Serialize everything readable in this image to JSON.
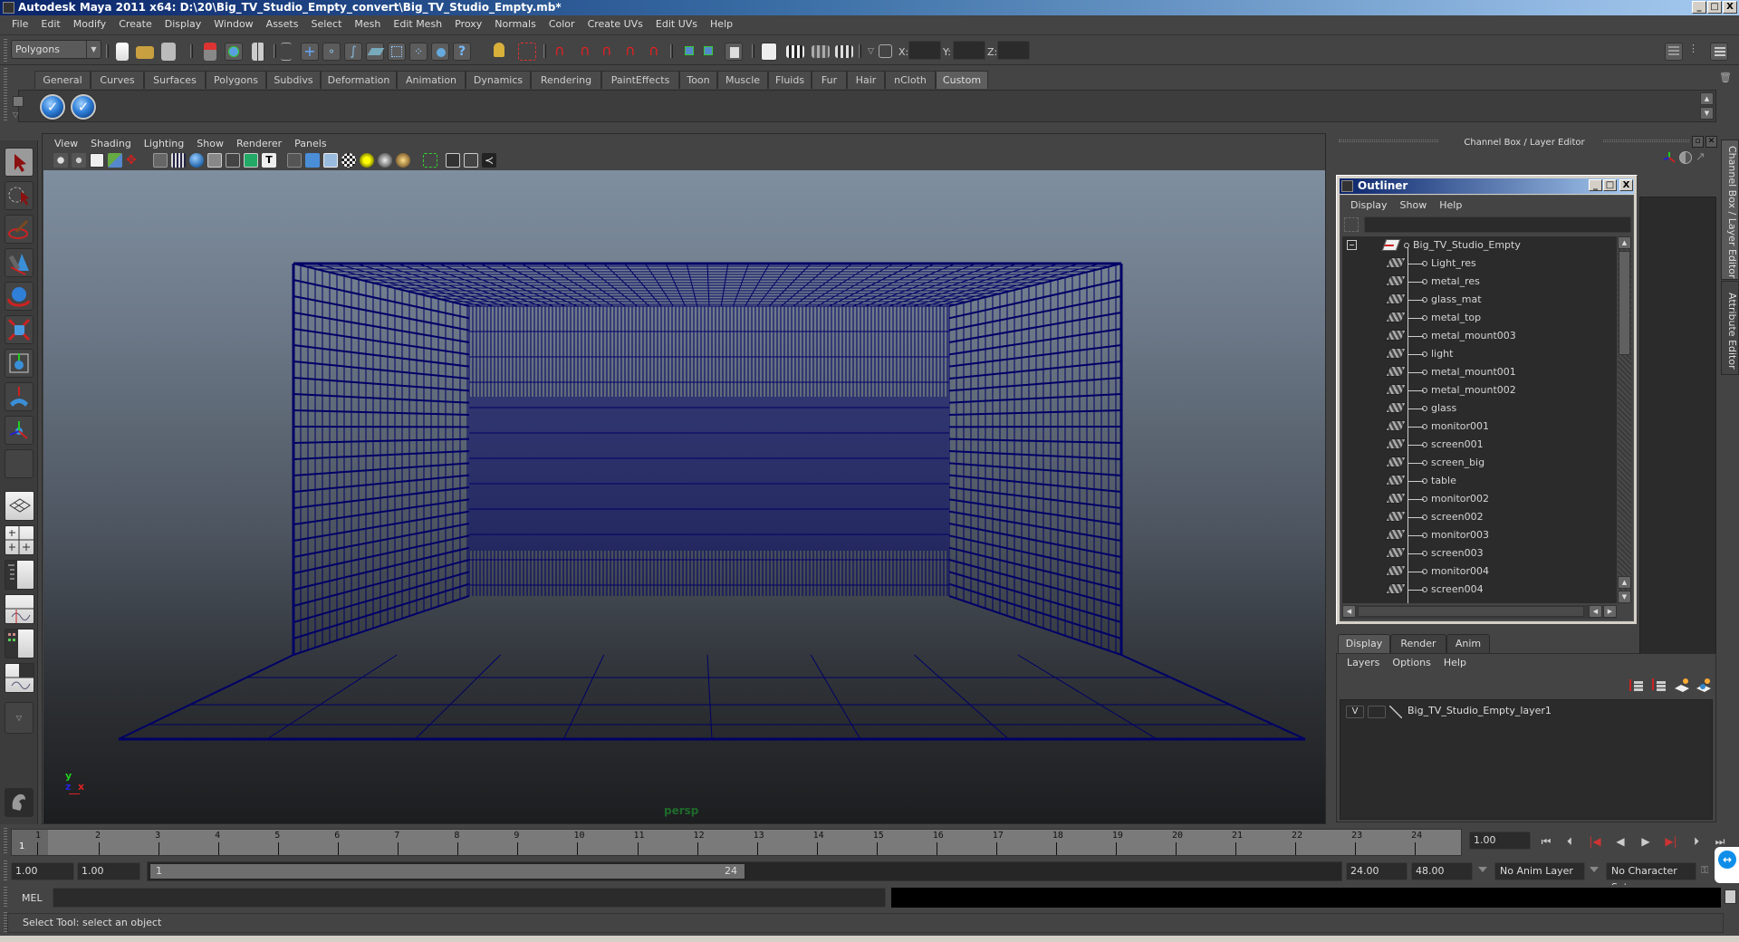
{
  "window": {
    "title": "Autodesk Maya 2011 x64: D:\\20\\Big_TV_Studio_Empty_convert\\Big_TV_Studio_Empty.mb*",
    "controls": [
      "_",
      "□",
      "X"
    ]
  },
  "menubar": [
    "File",
    "Edit",
    "Modify",
    "Create",
    "Display",
    "Window",
    "Assets",
    "Select",
    "Mesh",
    "Edit Mesh",
    "Proxy",
    "Normals",
    "Color",
    "Create UVs",
    "Edit UVs",
    "Help"
  ],
  "statusline": {
    "mode": "Polygons",
    "coord_labels": {
      "x": "X:",
      "y": "Y:",
      "z": "Z:"
    },
    "coord_values": {
      "x": "",
      "y": "",
      "z": ""
    },
    "icons": [
      "new-scene-icon",
      "open-scene-icon",
      "save-scene-icon",
      "select-by-hierarchy-icon",
      "select-by-object-icon",
      "select-by-component-icon",
      "mask-menu-icon",
      "select-handles-icon",
      "select-joints-icon",
      "select-curves-icon",
      "select-surfaces-icon",
      "select-deformations-icon",
      "select-dynamics-icon",
      "select-rendering-icon",
      "select-misc-icon",
      "lock-selection-icon",
      "highlight-selection-icon",
      "snap-grid-icon",
      "snap-curve-icon",
      "snap-point-icon",
      "snap-view-plane-icon",
      "make-live-icon",
      "input-ops-icon",
      "output-ops-icon",
      "construction-history-icon",
      "render-view-icon",
      "render-current-icon",
      "ipr-render-icon",
      "render-settings-icon",
      "transform-field-icon"
    ]
  },
  "shelf": {
    "tabs": [
      "General",
      "Curves",
      "Surfaces",
      "Polygons",
      "Subdivs",
      "Deformation",
      "Animation",
      "Dynamics",
      "Rendering",
      "PaintEffects",
      "Toon",
      "Muscle",
      "Fluids",
      "Fur",
      "Hair",
      "nCloth",
      "Custom"
    ],
    "active_tab": "Custom",
    "buttons": [
      "checkmark-shelf-icon",
      "checkmark-shelf-icon"
    ]
  },
  "toolbox": {
    "tools": [
      "select-tool",
      "lasso-tool",
      "paint-select-tool",
      "move-tool",
      "rotate-tool",
      "scale-tool",
      "universal-manipulator-tool",
      "soft-mod-tool",
      "show-manipulator-tool",
      "last-tool-slot"
    ],
    "layouts": [
      "single-perspective-layout",
      "four-view-layout",
      "outliner-perspective-layout",
      "perspective-graph-layout",
      "hypershade-perspective-layout",
      "perspective-hypergraph-graph-layout"
    ]
  },
  "viewport": {
    "menu": [
      "View",
      "Shading",
      "Lighting",
      "Show",
      "Renderer",
      "Panels"
    ],
    "camera_label": "persp",
    "axis": {
      "y": "y",
      "z": "z",
      "x": "x"
    },
    "wire_color": "#000066"
  },
  "channel_box": {
    "header": "Channel Box / Layer Editor",
    "vertical_tabs": [
      "Channel Box / Layer Editor",
      "Attribute Editor"
    ]
  },
  "outliner": {
    "title": "Outliner",
    "menu": [
      "Display",
      "Show",
      "Help"
    ],
    "filter_value": "",
    "root": "Big_TV_Studio_Empty",
    "children": [
      "Light_res",
      "metal_res",
      "glass_mat",
      "metal_top",
      "metal_mount003",
      "light",
      "metal_mount001",
      "metal_mount002",
      "glass",
      "monitor001",
      "screen001",
      "screen_big",
      "table",
      "monitor002",
      "screen002",
      "monitor003",
      "screen003",
      "monitor004",
      "screen004"
    ]
  },
  "layer_editor": {
    "tabs": [
      "Display",
      "Render",
      "Anim"
    ],
    "active_tab": "Display",
    "menu": [
      "Layers",
      "Options",
      "Help"
    ],
    "layers": [
      {
        "visible": "V",
        "name": "Big_TV_Studio_Empty_layer1"
      }
    ]
  },
  "timeline": {
    "frames": [
      "1",
      "2",
      "3",
      "4",
      "5",
      "6",
      "7",
      "8",
      "9",
      "10",
      "11",
      "12",
      "13",
      "14",
      "15",
      "16",
      "17",
      "18",
      "19",
      "20",
      "21",
      "22",
      "23",
      "24"
    ],
    "current_frame_marker": "1",
    "current_time": "1.00"
  },
  "range": {
    "start_time": "1.00",
    "playback_start": "1.00",
    "slider_start": "1",
    "slider_end": "24",
    "playback_end": "24.00",
    "end_time": "48.00",
    "anim_layer": "No Anim Layer",
    "character_set": "No Character Set"
  },
  "command_line": {
    "label": "MEL",
    "input_value": "",
    "output_value": ""
  },
  "help_line": "Select Tool: select an object"
}
